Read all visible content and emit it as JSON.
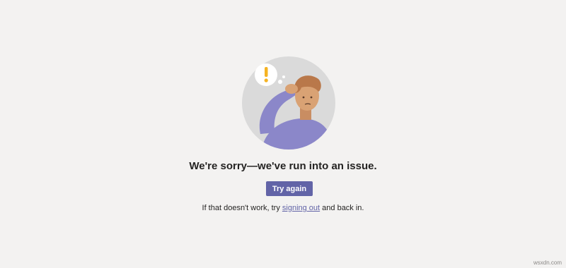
{
  "illustration": {
    "icon": "confused-person-with-exclamation-icon",
    "colors": {
      "circle": "#dadada",
      "shirt": "#8b87c9",
      "skin": "#d9a274",
      "hair": "#b9784a",
      "exclamation": "#f5b323"
    }
  },
  "error": {
    "headline": "We're sorry—we've run into an issue.",
    "try_again_label": "Try again",
    "hint_prefix": "If that doesn't work, try ",
    "sign_out_link": "signing out",
    "hint_suffix": " and back in."
  },
  "watermark": {
    "text": "wsxdn.com"
  },
  "colors": {
    "background": "#f3f2f1",
    "accent": "#6264a7",
    "text": "#252423"
  }
}
